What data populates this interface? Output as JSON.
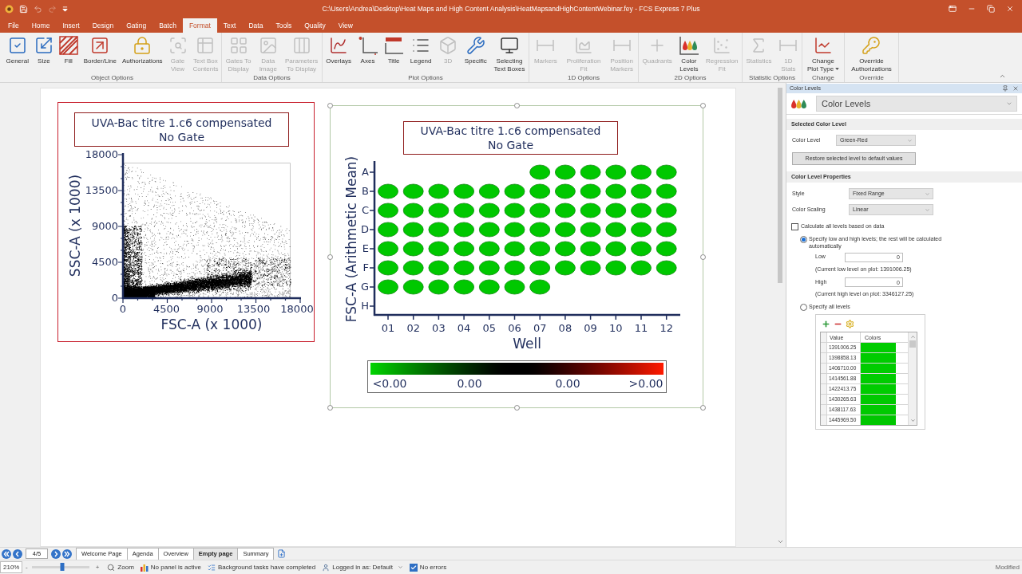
{
  "window": {
    "title": "C:\\Users\\Andrea\\Desktop\\Heat Maps and High Content Analysis\\HeatMapsandHighContentWebinar.fey - FCS Express 7 Plus"
  },
  "menu_tabs": [
    {
      "label": "File",
      "selected": false
    },
    {
      "label": "Home",
      "selected": false
    },
    {
      "label": "Insert",
      "selected": false
    },
    {
      "label": "Design",
      "selected": false
    },
    {
      "label": "Gating",
      "selected": false
    },
    {
      "label": "Batch",
      "selected": false
    },
    {
      "label": "Format",
      "selected": true
    },
    {
      "label": "Text",
      "selected": false
    },
    {
      "label": "Data",
      "selected": false
    },
    {
      "label": "Tools",
      "selected": false
    },
    {
      "label": "Quality",
      "selected": false
    },
    {
      "label": "View",
      "selected": false
    }
  ],
  "ribbon": {
    "groups": [
      {
        "label": "Object Options",
        "buttons": [
          {
            "label": [
              "General"
            ],
            "disabled": false,
            "dropdown": false
          },
          {
            "label": [
              "Size"
            ],
            "disabled": false,
            "dropdown": false
          },
          {
            "label": [
              "Fill"
            ],
            "disabled": false,
            "dropdown": false
          },
          {
            "label": [
              "Border/Line"
            ],
            "disabled": false,
            "dropdown": false
          },
          {
            "label": [
              "Authorizations"
            ],
            "disabled": false,
            "dropdown": false
          },
          {
            "label": [
              "Gate",
              "View"
            ],
            "disabled": true,
            "dropdown": false
          },
          {
            "label": [
              "Text Box",
              "Contents"
            ],
            "disabled": true,
            "dropdown": false
          }
        ]
      },
      {
        "label": "Data Options",
        "buttons": [
          {
            "label": [
              "Gates To",
              "Display"
            ],
            "disabled": true,
            "dropdown": false
          },
          {
            "label": [
              "Data",
              "Image"
            ],
            "disabled": true,
            "dropdown": false
          },
          {
            "label": [
              "Parameters",
              "To Display"
            ],
            "disabled": true,
            "dropdown": false
          }
        ]
      },
      {
        "label": "Plot Options",
        "buttons": [
          {
            "label": [
              "Overlays"
            ],
            "disabled": false,
            "dropdown": false
          },
          {
            "label": [
              "Axes"
            ],
            "disabled": false,
            "dropdown": false
          },
          {
            "label": [
              "Title"
            ],
            "disabled": false,
            "dropdown": false
          },
          {
            "label": [
              "Legend"
            ],
            "disabled": false,
            "dropdown": false
          },
          {
            "label": [
              "3D"
            ],
            "disabled": true,
            "dropdown": false
          },
          {
            "label": [
              "Specific"
            ],
            "disabled": false,
            "dropdown": false
          },
          {
            "label": [
              "Selecting",
              "Text Boxes"
            ],
            "disabled": false,
            "dropdown": false
          }
        ]
      },
      {
        "label": "1D Options",
        "buttons": [
          {
            "label": [
              "Markers"
            ],
            "disabled": true,
            "dropdown": false
          },
          {
            "label": [
              "Proliferation",
              "Fit"
            ],
            "disabled": true,
            "dropdown": false
          },
          {
            "label": [
              "Position",
              "Markers"
            ],
            "disabled": true,
            "dropdown": false
          }
        ]
      },
      {
        "label": "2D Options",
        "buttons": [
          {
            "label": [
              "Quadrants"
            ],
            "disabled": true,
            "dropdown": false
          },
          {
            "label": [
              "Color",
              "Levels"
            ],
            "disabled": false,
            "dropdown": false
          },
          {
            "label": [
              "Regression",
              "Fit"
            ],
            "disabled": true,
            "dropdown": false
          }
        ]
      },
      {
        "label": "Statistic Options",
        "buttons": [
          {
            "label": [
              "Statistics"
            ],
            "disabled": true,
            "dropdown": false
          },
          {
            "label": [
              "1D",
              "Stats"
            ],
            "disabled": true,
            "dropdown": false
          }
        ]
      },
      {
        "label": "Change",
        "buttons": [
          {
            "label": [
              "Change",
              "Plot Type"
            ],
            "disabled": false,
            "dropdown": true
          }
        ]
      },
      {
        "label": "Override",
        "buttons": [
          {
            "label": [
              "Override",
              "Authorizations"
            ],
            "disabled": false,
            "dropdown": false
          }
        ]
      }
    ]
  },
  "plots": [
    {
      "kind": "dot_plot",
      "selected": false,
      "framed": true,
      "title": "UVA-Bac titre 1.c6 compensated",
      "subtitle": "No Gate",
      "x_label": "FSC-A (x 1000)",
      "y_label": "SSC-A (x 1000)",
      "x_ticks": [
        "0",
        "4500",
        "9000",
        "13500",
        "18000"
      ],
      "y_ticks": [
        "18000",
        "13500",
        "9000",
        "4500",
        "0"
      ]
    },
    {
      "kind": "heat_map",
      "selected": true,
      "framed": false,
      "title": "UVA-Bac titre 1.c6 compensated",
      "subtitle": "No Gate",
      "x_label": "Well",
      "y_label": "FSC-A (Arithmetic Mean)",
      "columns": [
        "01",
        "02",
        "03",
        "04",
        "05",
        "06",
        "07",
        "08",
        "09",
        "10",
        "11",
        "12"
      ],
      "rows": [
        {
          "label": "A",
          "wells": [
            false,
            false,
            false,
            false,
            false,
            false,
            true,
            true,
            true,
            true,
            true,
            true
          ]
        },
        {
          "label": "B",
          "wells": [
            true,
            true,
            true,
            true,
            true,
            true,
            true,
            true,
            true,
            true,
            true,
            true
          ]
        },
        {
          "label": "C",
          "wells": [
            true,
            true,
            true,
            true,
            true,
            true,
            true,
            true,
            true,
            true,
            true,
            true
          ]
        },
        {
          "label": "D",
          "wells": [
            true,
            true,
            true,
            true,
            true,
            true,
            true,
            true,
            true,
            true,
            true,
            true
          ]
        },
        {
          "label": "E",
          "wells": [
            true,
            true,
            true,
            true,
            true,
            true,
            true,
            true,
            true,
            true,
            true,
            true
          ]
        },
        {
          "label": "F",
          "wells": [
            true,
            true,
            true,
            true,
            true,
            true,
            true,
            true,
            true,
            true,
            true,
            true
          ]
        },
        {
          "label": "G",
          "wells": [
            true,
            true,
            true,
            true,
            true,
            true,
            true,
            false,
            false,
            false,
            false,
            false
          ]
        },
        {
          "label": "H",
          "wells": [
            false,
            false,
            false,
            false,
            false,
            false,
            false,
            false,
            false,
            false,
            false,
            false
          ]
        }
      ],
      "scale_labels": [
        "<0.00",
        "0.00",
        "0.00",
        ">0.00"
      ]
    }
  ],
  "panel": {
    "title": "Color Levels",
    "selector": "Color Levels",
    "selected_level": {
      "heading": "Selected Color Level",
      "label": "Color Level",
      "value": "Green-Red",
      "restore_button": "Restore selected level to default values"
    },
    "properties": {
      "heading": "Color Level Properties",
      "fields": [
        {
          "label": "Style",
          "value": "Fixed Range"
        },
        {
          "label": "Color Scaling",
          "value": "Linear"
        }
      ],
      "calculate_all": {
        "label": "Calculate all levels based on data",
        "checked": false
      },
      "modes": [
        {
          "kind": "low_high",
          "label": "Specify low and high levels; the rest will be calculated automatically",
          "selected": true,
          "limits": [
            {
              "label": "Low",
              "value": "0",
              "note": "(Current low level on plot: 1391006.25)"
            },
            {
              "label": "High",
              "value": "0",
              "note": "(Current high level on plot: 3346127.25)"
            }
          ]
        },
        {
          "kind": "all_levels",
          "label": "Specify all levels",
          "selected": false,
          "table": {
            "columns": [
              "Value",
              "Colors"
            ],
            "rows": [
              {
                "value": "1391006.25",
                "color": "#00cc00"
              },
              {
                "value": "1398858.13",
                "color": "#00cc00"
              },
              {
                "value": "1406710.00",
                "color": "#00cc00"
              },
              {
                "value": "1414561.88",
                "color": "#00cc00"
              },
              {
                "value": "1422413.75",
                "color": "#00cc00"
              },
              {
                "value": "1430265.63",
                "color": "#00c900"
              },
              {
                "value": "1438117.63",
                "color": "#00c900"
              },
              {
                "value": "1445969.50",
                "color": "#00c600"
              }
            ]
          }
        }
      ]
    }
  },
  "page_navigator": {
    "page": "4/5"
  },
  "page_tabs": [
    {
      "label": "Welcome Page",
      "selected": false
    },
    {
      "label": "Agenda",
      "selected": false
    },
    {
      "label": "Overview",
      "selected": false
    },
    {
      "label": "Empty page",
      "selected": true
    },
    {
      "label": "Summary",
      "selected": false
    }
  ],
  "status_bar": {
    "zoom": "210%",
    "zoom_minus": "-",
    "zoom_plus": "+",
    "zoom_slider": {
      "level": 0.53
    },
    "items": [
      {
        "kind": "zoom",
        "label": "Zoom"
      },
      {
        "kind": "panel",
        "label": "No panel is active"
      },
      {
        "kind": "tasks",
        "label": "Background tasks have completed"
      },
      {
        "kind": "user",
        "label": "Logged in as: Default"
      },
      {
        "kind": "errors",
        "label": "No errors",
        "checked": true
      }
    ],
    "state": "Modified"
  }
}
